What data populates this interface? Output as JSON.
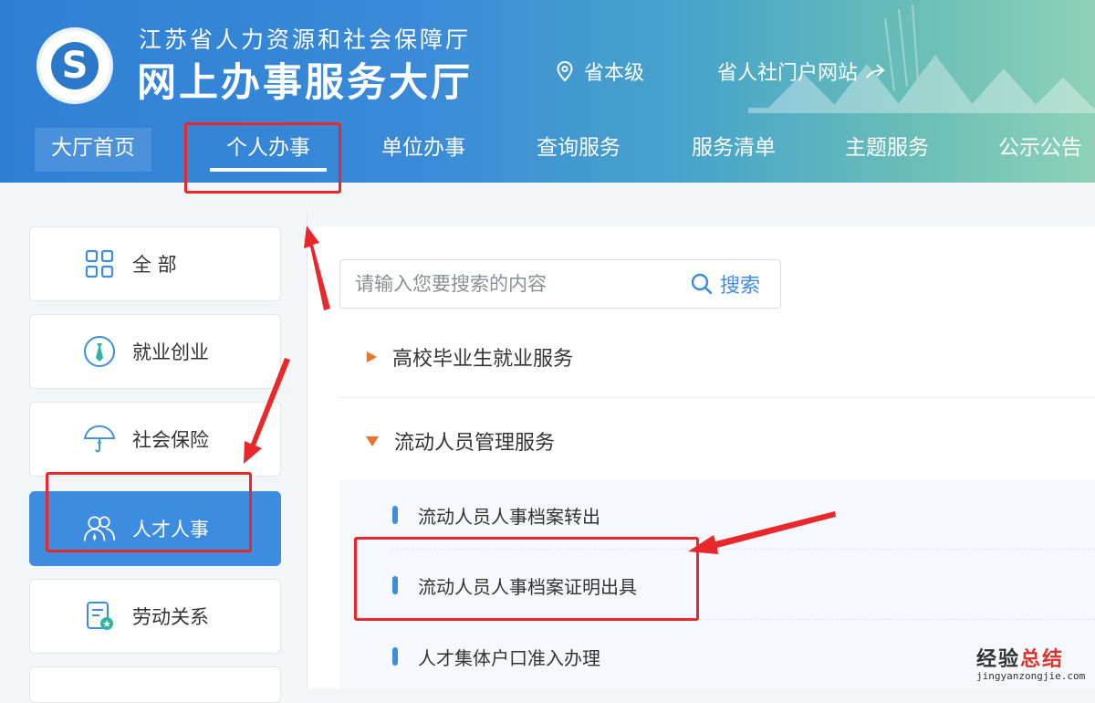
{
  "header": {
    "org_name": "江苏省人力资源和社会保障厅",
    "hall_name": "网上办事服务大厅",
    "location": "省本级",
    "portal_link": "省人社门户网站"
  },
  "nav": {
    "items": [
      "大厅首页",
      "个人办事",
      "单位办事",
      "查询服务",
      "服务清单",
      "主题服务",
      "公示公告"
    ],
    "active": "个人办事"
  },
  "sidebar": {
    "items": [
      {
        "label": "全 部",
        "icon": "grid-icon"
      },
      {
        "label": "就业创业",
        "icon": "tie-icon"
      },
      {
        "label": "社会保险",
        "icon": "umbrella-icon"
      },
      {
        "label": "人才人事",
        "icon": "people-icon"
      },
      {
        "label": "劳动关系",
        "icon": "document-star-icon"
      }
    ],
    "active": "人才人事"
  },
  "search": {
    "placeholder": "请输入您要搜索的内容",
    "button_label": "搜索"
  },
  "categories": [
    {
      "label": "高校毕业生就业服务",
      "expanded": false
    },
    {
      "label": "流动人员管理服务",
      "expanded": true,
      "items": [
        "流动人员人事档案转出",
        "流动人员人事档案证明出具",
        "人才集体户口准入办理"
      ]
    }
  ],
  "watermark": {
    "line1_a": "经验",
    "line1_b": "总结",
    "line2": "jingyanzongjie.com"
  },
  "colors": {
    "accent": "#3d8ce0",
    "annotation_red": "#e8282b",
    "expand_arrow": "#e8732c"
  }
}
